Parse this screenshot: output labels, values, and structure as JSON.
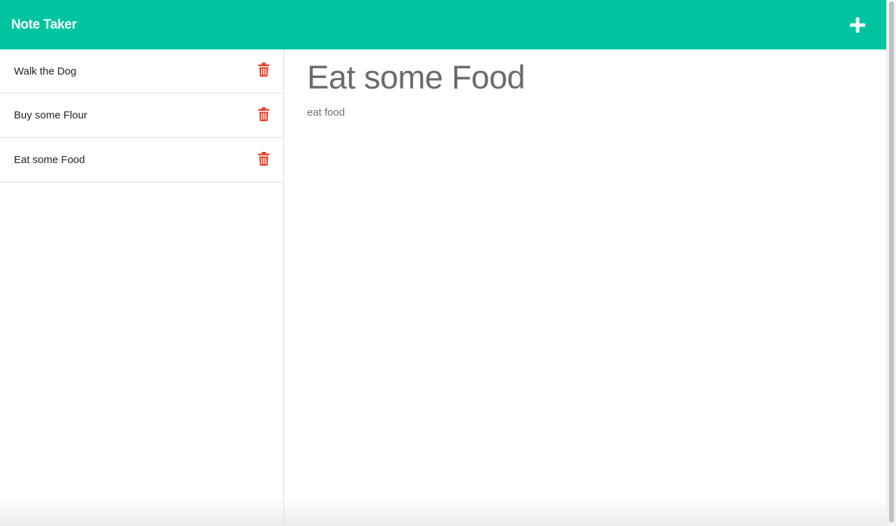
{
  "header": {
    "title": "Note Taker",
    "add_icon": "plus-icon"
  },
  "sidebar": {
    "notes": [
      {
        "title": "Walk the Dog",
        "delete_icon": "trash-icon"
      },
      {
        "title": "Buy some Flour",
        "delete_icon": "trash-icon"
      },
      {
        "title": "Eat some Food",
        "delete_icon": "trash-icon"
      }
    ]
  },
  "main": {
    "title": "Eat some Food",
    "text": "eat food"
  },
  "colors": {
    "accent": "#00c49f",
    "delete": "#e8442f",
    "heading": "#6c6c6c"
  }
}
